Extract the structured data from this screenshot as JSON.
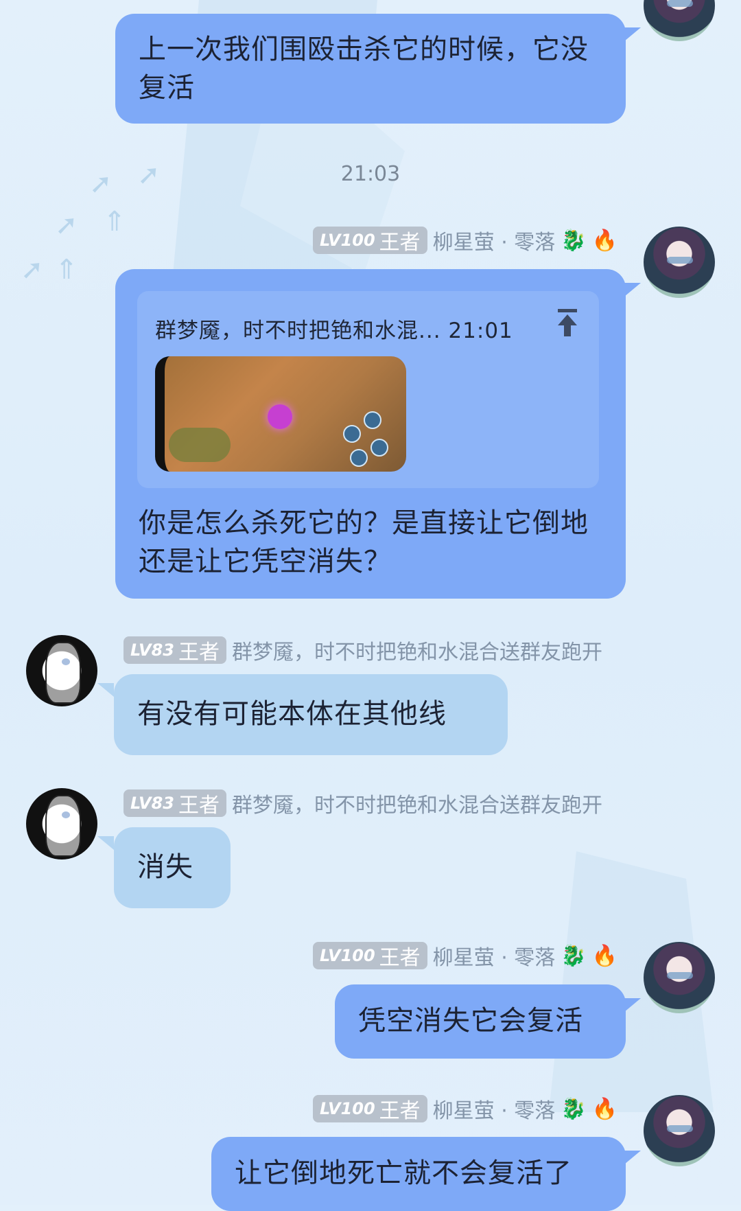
{
  "messages": [
    {
      "id": "m1",
      "sender": "me",
      "text": "上一次我们围殴击杀它的时候，它没复活"
    },
    {
      "id": "m2",
      "sender": "me",
      "level": "LV100",
      "title": "王者",
      "name": "柳星萤 · 零落",
      "reply": {
        "title": "群梦魇，时不时把铯和水混...",
        "time": "21:01"
      },
      "text": "你是怎么杀死它的？是直接让它倒地还是让它凭空消失？"
    },
    {
      "id": "m3",
      "sender": "other",
      "level": "LV83",
      "title": "王者",
      "name": "群梦魇，时不时把铯和水混合送群友跑开",
      "text": "有没有可能本体在其他线"
    },
    {
      "id": "m4",
      "sender": "other",
      "level": "LV83",
      "title": "王者",
      "name": "群梦魇，时不时把铯和水混合送群友跑开",
      "text": "消失"
    },
    {
      "id": "m5",
      "sender": "me",
      "level": "LV100",
      "title": "王者",
      "name": "柳星萤 · 零落",
      "text": "凭空消失它会复活"
    },
    {
      "id": "m6",
      "sender": "me",
      "level": "LV100",
      "title": "王者",
      "name": "柳星萤 · 零落",
      "text": "让它倒地死亡就不会复活了"
    }
  ],
  "timestamp": "21:03",
  "icons": {
    "badge_dragon": "🐉",
    "badge_fire": "🔥",
    "reply_jump": "arrow-up-to-top-icon"
  },
  "colors": {
    "my_bubble": "#7ea9f7",
    "other_bubble": "#b3d5f2",
    "background": "#e0eefa"
  }
}
